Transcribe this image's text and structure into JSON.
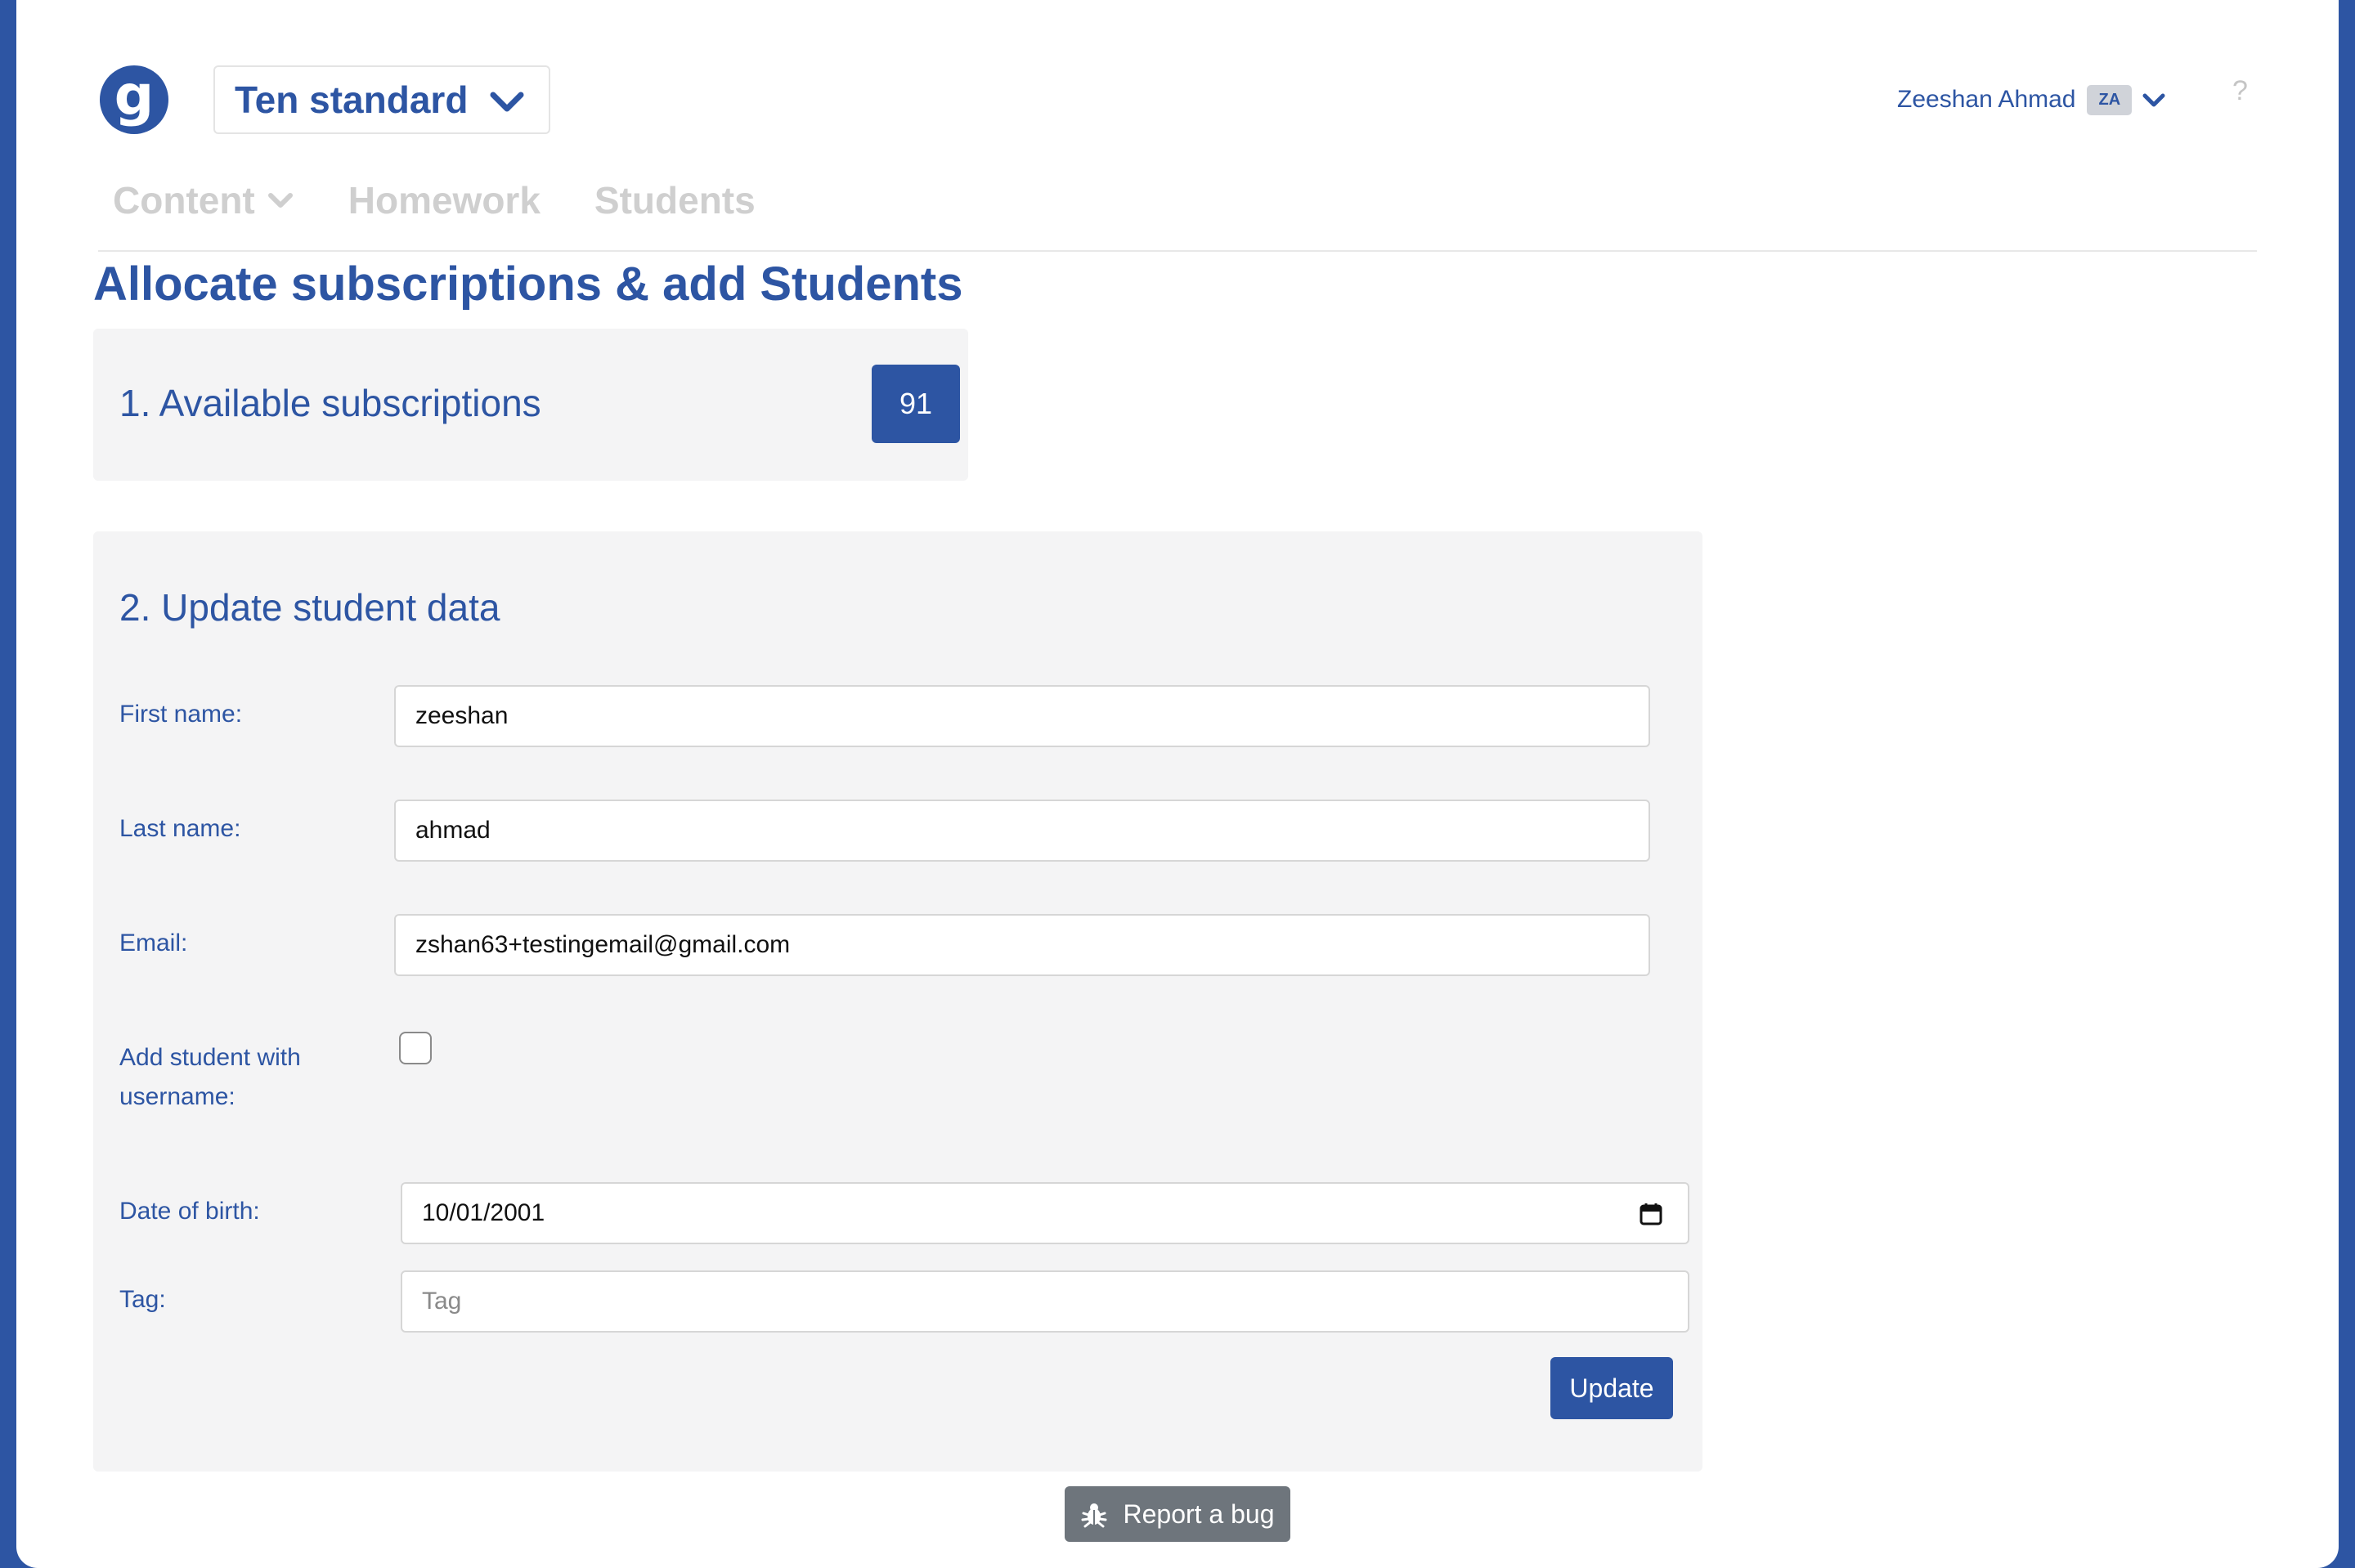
{
  "header": {
    "logo_letter": "g",
    "course_label": "Ten standard",
    "user_name": "Zeeshan Ahmad",
    "user_initials": "ZA",
    "help": "?"
  },
  "nav": {
    "items": [
      {
        "label": "Content",
        "has_chevron": true
      },
      {
        "label": "Homework"
      },
      {
        "label": "Students"
      }
    ]
  },
  "page": {
    "title": "Allocate subscriptions & add Students"
  },
  "subscriptions": {
    "heading": "1. Available subscriptions",
    "count": "91"
  },
  "form": {
    "heading": "2. Update student data",
    "first_name_label": "First name:",
    "first_name_value": "zeeshan",
    "last_name_label": "Last name:",
    "last_name_value": "ahmad",
    "email_label": "Email:",
    "email_value": "zshan63+testingemail@gmail.com",
    "username_label_line1": "Add student with",
    "username_label_line2": "username:",
    "username_checked": false,
    "dob_label": "Date of birth:",
    "dob_value": "10/01/2001",
    "tag_label": "Tag:",
    "tag_placeholder": "Tag",
    "tag_value": "",
    "update_label": "Update"
  },
  "footer": {
    "report_bug_label": "Report a bug"
  },
  "colors": {
    "brand": "#2d55a3",
    "panel_bg": "#f4f4f5",
    "nav_inactive": "#cfcfcf",
    "bug_button": "#6e757c"
  }
}
